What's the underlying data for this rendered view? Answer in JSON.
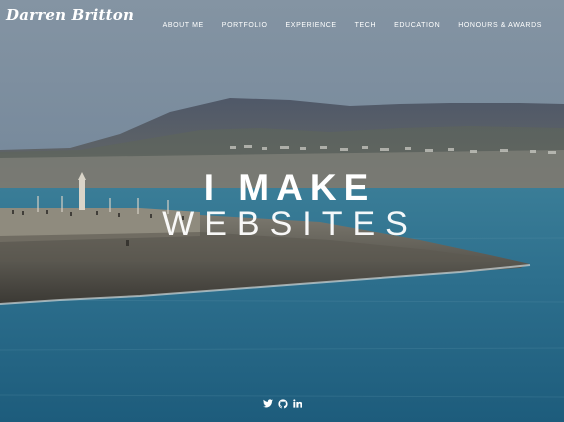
{
  "brand": {
    "name": "Darren Britton"
  },
  "nav": {
    "items": [
      {
        "label": "ABOUT ME"
      },
      {
        "label": "PORTFOLIO"
      },
      {
        "label": "EXPERIENCE"
      },
      {
        "label": "TECH"
      },
      {
        "label": "EDUCATION"
      },
      {
        "label": "HONOURS & AWARDS"
      }
    ]
  },
  "hero": {
    "headline_main": "I MAKE",
    "headline_sub": "WEBSITES"
  },
  "social": {
    "icons": [
      "twitter-icon",
      "github-icon",
      "linkedin-icon"
    ]
  },
  "colors": {
    "sky": "#7d8f9f",
    "sea": "#2b6f8e",
    "text": "#ffffff"
  }
}
